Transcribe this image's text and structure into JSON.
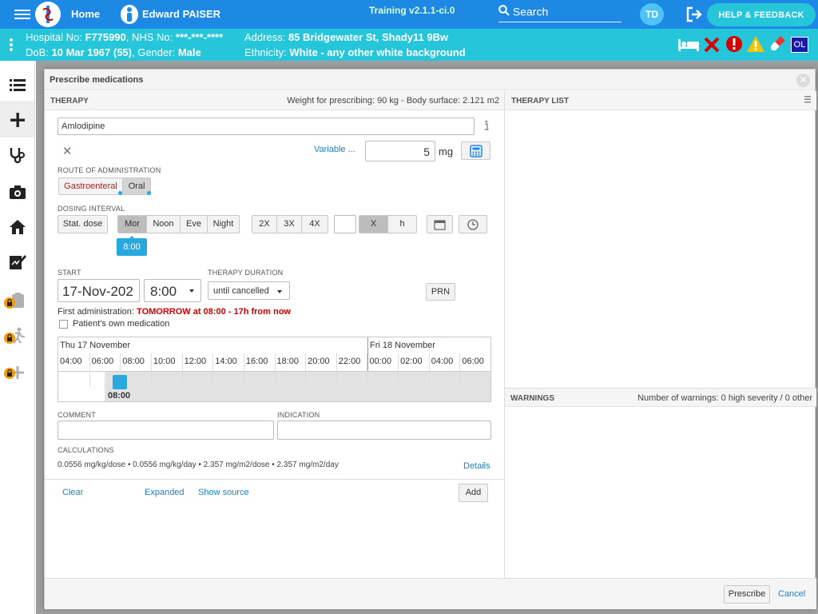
{
  "header": {
    "home": "Home",
    "user": "Edward PAISER",
    "version": "Training v2.1.1-ci.0",
    "search": "Search",
    "initials": "TD",
    "help": "HELP & FEEDBACK"
  },
  "patient": {
    "hosp_label": "Hospital No:",
    "hosp": "F775990",
    "nhs_label": ", NHS No:",
    "nhs": "***-***-****",
    "dob_label": "DoB:",
    "dob": "10 Mar 1967 (55)",
    "gender_label": ", Gender:",
    "gender": "Male",
    "addr_label": "Address:",
    "addr": "85 Bridgewater St, Shady11 9Bw",
    "eth_label": "Ethnicity:",
    "eth": "White - any other white background",
    "badge": "OL"
  },
  "dialog": {
    "title": "Prescribe medications",
    "therapy_label": "THERAPY",
    "weight": "Weight for prescribing: 90 kg - Body surface: 2.121 m2",
    "therapy_list": "THERAPY LIST",
    "warnings": "WARNINGS",
    "warn_count": "Number of warnings: 0 high severity / 0 other",
    "drug": "Amlodipine",
    "variable": "Variable ...",
    "dose": "5",
    "unit": "mg",
    "route_label": "ROUTE OF ADMINISTRATION",
    "routes": [
      "Gastroenteral",
      "Oral"
    ],
    "dosing_label": "DOSING INTERVAL",
    "stat": "Stat. dose",
    "times": [
      "Mor",
      "Noon",
      "Eve",
      "Night"
    ],
    "freq": [
      "2X",
      "3X",
      "4X"
    ],
    "xh": [
      "X",
      "h"
    ],
    "time_tag": "8:00",
    "start_label": "START",
    "start_date": "17-Nov-202",
    "start_time": "8:00",
    "duration_label": "THERAPY DURATION",
    "duration": "until cancelled",
    "prn": "PRN",
    "first_admin_label": "First administration:",
    "first_admin": "TOMORROW at 08:00 - 17h from now",
    "own_med": "Patient's own medication",
    "tl_day1": "Thu 17 November",
    "tl_day2": "Fri 18 November",
    "tl_hours": [
      "04:00",
      "06:00",
      "08:00",
      "10:00",
      "12:00",
      "14:00",
      "16:00",
      "18:00",
      "20:00",
      "22:00",
      "00:00",
      "02:00",
      "04:00",
      "06:00"
    ],
    "tl_event": "08:00",
    "comment_label": "COMMENT",
    "indication_label": "INDICATION",
    "calc_label": "CALCULATIONS",
    "calc": "0.0556 mg/kg/dose • 0.0556 mg/kg/day • 2.357 mg/m2/dose • 2.357 mg/m2/day",
    "details": "Details",
    "clear": "Clear",
    "expanded": "Expanded",
    "show_source": "Show source",
    "add": "Add",
    "prescribe": "Prescribe",
    "cancel": "Cancel"
  },
  "colors": {
    "topbar": "#1e88e5",
    "patientbar": "#26c6da",
    "accent": "#29a8e0",
    "alert": "#d40000"
  },
  "icons": [
    "menu-icon",
    "logo-icon",
    "person-icon",
    "search-icon",
    "logout-icon",
    "bed-icon",
    "cross-icon",
    "exclamation-icon",
    "warning-icon",
    "pill-icon",
    "list-icon",
    "plus-icon",
    "stethoscope-icon",
    "camera-icon",
    "house-icon",
    "signature-icon",
    "lock-icon",
    "info-icon",
    "calculator-icon",
    "calendar-icon",
    "clock-icon"
  ]
}
